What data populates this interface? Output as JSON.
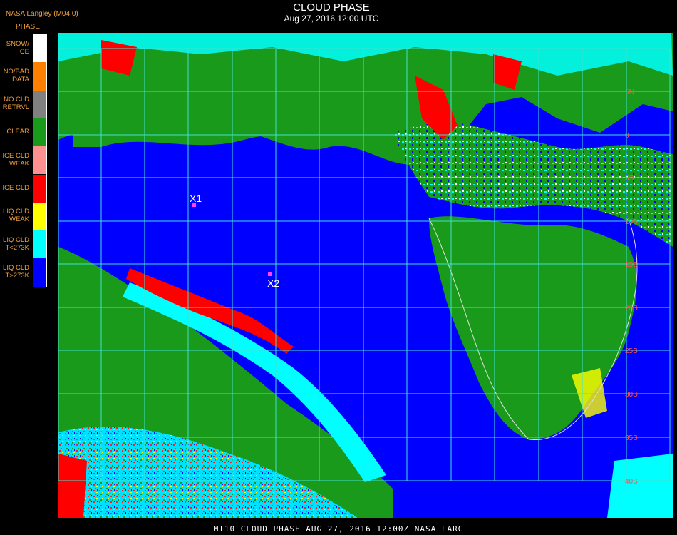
{
  "header": {
    "source": "NASA Langley (M04.0)",
    "title": "CLOUD PHASE",
    "subtitle": "Aug 27, 2016 12:00 UTC"
  },
  "legend": {
    "title": "PHASE",
    "items": [
      {
        "label": "SNOW/\nICE",
        "color": "#ffffff"
      },
      {
        "label": "NO/BAD\nDATA",
        "color": "#ff8000"
      },
      {
        "label": "NO CLD\nRETRVL",
        "color": "#808080"
      },
      {
        "label": "CLEAR",
        "color": "#1a9a1a"
      },
      {
        "label": "ICE CLD\nWEAK",
        "color": "#ff9090"
      },
      {
        "label": "ICE CLD",
        "color": "#ff0000"
      },
      {
        "label": "LIQ CLD\nWEAK",
        "color": "#ffff00"
      },
      {
        "label": "LIQ CLD\nT<273K",
        "color": "#00ffff"
      },
      {
        "label": "LIQ CLD\nT>273K",
        "color": "#0000ff"
      }
    ]
  },
  "map": {
    "latitude_labels": [
      "5N",
      "0",
      "5S",
      "10S",
      "15S",
      "20S",
      "25S",
      "30S",
      "35S",
      "40S"
    ],
    "markers": [
      {
        "label": "X1",
        "color": "#ff40ff"
      },
      {
        "label": "X2",
        "color": "#ff40ff"
      }
    ],
    "grid_color": "#40e0d0"
  },
  "footer": {
    "text": "MT10  CLOUD PHASE   AUG 27, 2016 12:00Z   NASA LARC"
  }
}
